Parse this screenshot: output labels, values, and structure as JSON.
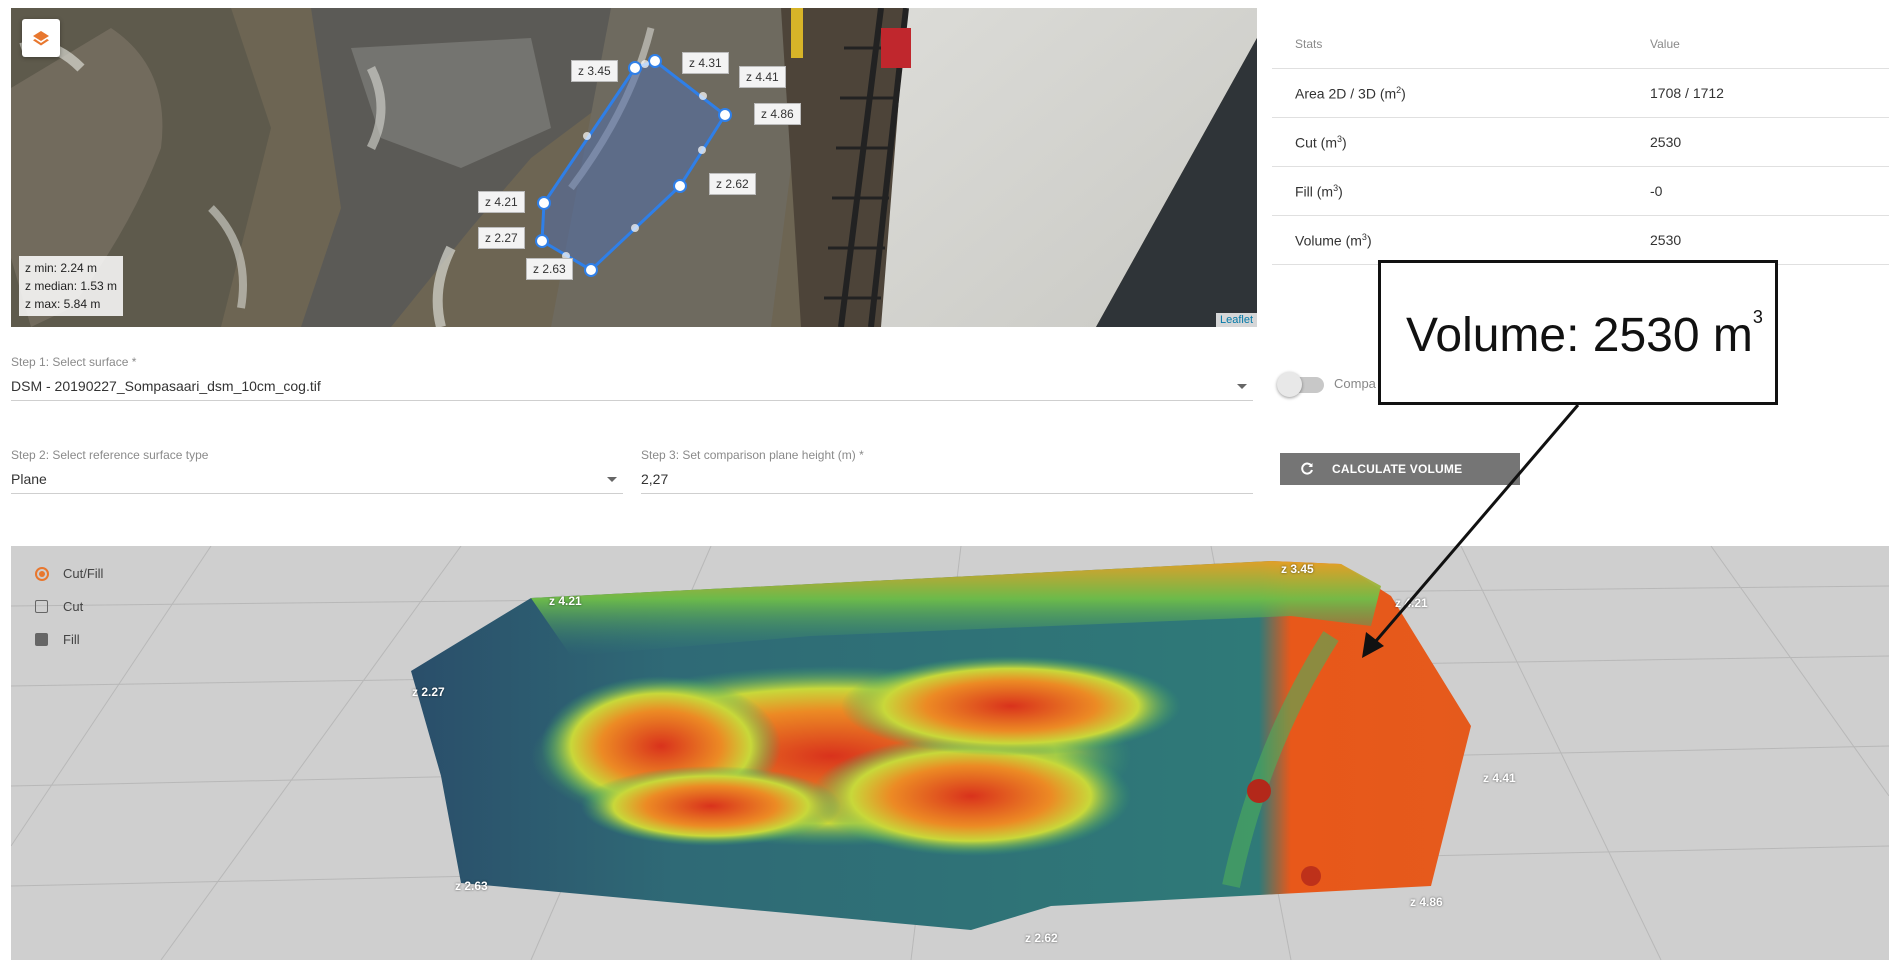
{
  "map": {
    "layers_icon": "layers-icon",
    "z_labels": [
      "z 3.45",
      "z 4.31",
      "z 4.41",
      "z 4.86",
      "z 2.62",
      "z 4.21",
      "z 2.27",
      "z 2.63"
    ],
    "stats_lines": [
      "z min: 2.24 m",
      "z median: 1.53 m",
      "z max: 5.84 m"
    ],
    "attribution": "Leaflet"
  },
  "stats": {
    "header": {
      "stat": "Stats",
      "value": "Value"
    },
    "rows": [
      {
        "label": "Area 2D / 3D (m",
        "sup": "2",
        "suffix": ")",
        "value": "1708 / 1712"
      },
      {
        "label": "Cut (m",
        "sup": "3",
        "suffix": ")",
        "value": "2530"
      },
      {
        "label": "Fill (m",
        "sup": "3",
        "suffix": ")",
        "value": "-0"
      },
      {
        "label": "Volume (m",
        "sup": "3",
        "suffix": ")",
        "value": "2530"
      }
    ]
  },
  "form": {
    "step1_label": "Step 1: Select surface *",
    "step1_value": "DSM - 20190227_Sompasaari_dsm_10cm_cog.tif",
    "step2_label": "Step 2: Select reference surface type",
    "step2_value": "Plane",
    "step3_label": "Step 3: Set comparison plane height (m) *",
    "step3_value": "2,27",
    "toggle_label": "Compa",
    "calc_button": "CALCULATE VOLUME",
    "calc_icon": "refresh-icon"
  },
  "view3d": {
    "modes": [
      "Cut/Fill",
      "Cut",
      "Fill"
    ],
    "selected_mode": "Cut/Fill",
    "z_labels": [
      "z 3.45",
      "z 4.21",
      "z 4.21",
      "z 2.27",
      "z 4.41",
      "z 2.63",
      "z 4.86",
      "z 2.62"
    ]
  },
  "callout": {
    "text": "Volume: 2530 m",
    "sup": "3"
  },
  "colors": {
    "accent": "#e8772e",
    "polygon": "#2f7fe8",
    "button": "#757575"
  }
}
